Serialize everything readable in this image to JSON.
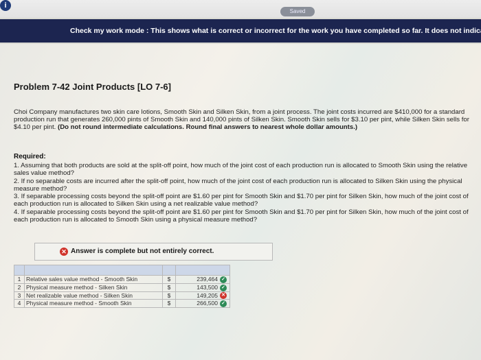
{
  "top_bar": {
    "saved_label": "Saved"
  },
  "banner": {
    "text": "Check my work mode : This shows what is correct or incorrect for the work you have completed so far. It does not indicate"
  },
  "problem": {
    "title": "Problem 7-42 Joint Products [LO 7-6]",
    "intro_text": "Choi Company manufactures two skin care lotions, Smooth Skin and Silken Skin, from a joint process. The joint costs incurred are $410,000 for a standard production run that generates 260,000 pints of Smooth Skin and 140,000 pints of Silken Skin. Smooth Skin sells for $3.10 per pint, while Silken Skin sells for $4.10 per pint.",
    "intro_bold": "(Do not round intermediate calculations. Round final answers to nearest whole dollar amounts.)",
    "required_title": "Required:",
    "requirements": [
      "1. Assuming that both products are sold at the split-off point, how much of the joint cost of each production run is allocated to Smooth Skin using the relative sales value method?",
      "2. If no separable costs are incurred after the split-off point, how much of the joint cost of each production run is allocated to Silken Skin using the physical measure method?",
      "3. If separable processing costs beyond the split-off point are $1.60 per pint for Smooth Skin and $1.70 per pint for Silken Skin, how much of the joint cost of each production run is allocated to Silken Skin using a net realizable value method?",
      "4. If separable processing costs beyond the split-off point are $1.60 per pint for Smooth Skin and $1.70 per pint for Silken Skin, how much of the joint cost of each production run is allocated to Smooth Skin using a physical measure method?"
    ]
  },
  "answer_status": {
    "message": "Answer is complete but not entirely correct."
  },
  "answer_table": {
    "rows": [
      {
        "num": "1",
        "label": "Relative sales value method - Smooth Skin",
        "currency": "$",
        "value": "239,464",
        "status": "correct"
      },
      {
        "num": "2",
        "label": "Physical measure method - Silken Skin",
        "currency": "$",
        "value": "143,500",
        "status": "correct"
      },
      {
        "num": "3",
        "label": "Net realizable value method - Silken Skin",
        "currency": "$",
        "value": "149,205",
        "status": "incorrect"
      },
      {
        "num": "4",
        "label": "Physical measure method - Smooth Skin",
        "currency": "$",
        "value": "266,500",
        "status": "correct"
      }
    ]
  },
  "colors": {
    "banner_bg": "#1c2550",
    "correct": "#2e8b57",
    "incorrect": "#d0342c",
    "table_header": "#cdd7e8"
  }
}
